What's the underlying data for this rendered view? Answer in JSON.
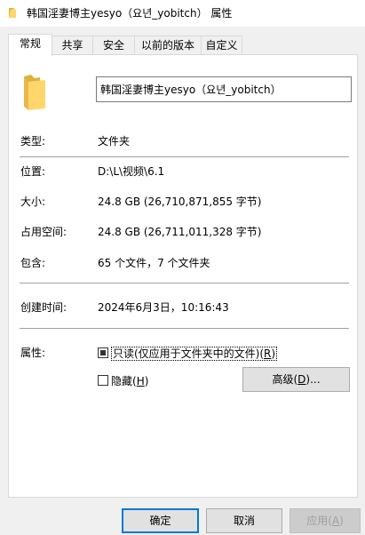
{
  "window": {
    "title": "韩国淫妻博主yesyo（요년_yobitch） 属性",
    "icon": "folder-icon"
  },
  "tabs": [
    {
      "label": "常规",
      "active": true
    },
    {
      "label": "共享",
      "active": false
    },
    {
      "label": "安全",
      "active": false
    },
    {
      "label": "以前的版本",
      "active": false
    },
    {
      "label": "自定义",
      "active": false
    }
  ],
  "general": {
    "folder_name": "韩国淫妻博主yesyo（요년_yobitch）",
    "type_label": "类型:",
    "type_value": "文件夹",
    "location_label": "位置:",
    "location_value": "D:\\L\\视频\\6.1",
    "size_label": "大小:",
    "size_value": "24.8 GB (26,710,871,855 字节)",
    "disk_size_label": "占用空间:",
    "disk_size_value": "24.8 GB (26,711,011,328 字节)",
    "contains_label": "包含:",
    "contains_value": "65 个文件，7 个文件夹",
    "created_label": "创建时间:",
    "created_value": "2024年6月3日，10:16:43",
    "attributes_label": "属性:",
    "readonly_label": "只读(仅应用于文件夹中的文件)(",
    "readonly_key": "R",
    "readonly_end": ")",
    "readonly_state": "indeterminate",
    "hidden_label": "隐藏(",
    "hidden_key": "H",
    "hidden_end": ")",
    "hidden_checked": false,
    "advanced_label": "高级(",
    "advanced_key": "D",
    "advanced_end": ")..."
  },
  "footer": {
    "ok_label": "确定",
    "cancel_label": "取消",
    "apply_label": "应用(",
    "apply_key": "A",
    "apply_end": ")"
  },
  "colors": {
    "folder": "#ffd66b",
    "focus": "#0078d7"
  }
}
